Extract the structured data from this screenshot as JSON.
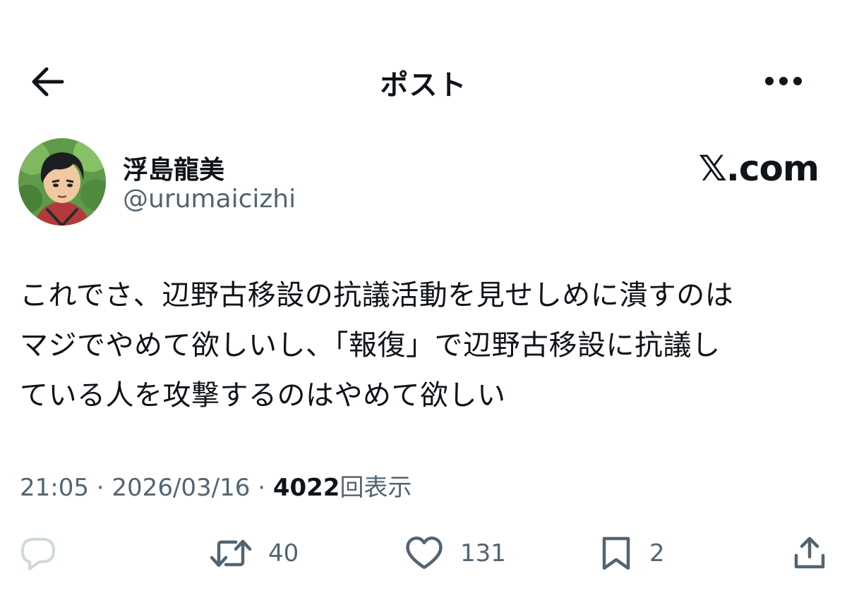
{
  "header": {
    "title": "ポスト",
    "back_icon": "arrow-left-icon",
    "more_icon": "more-horizontal-icon"
  },
  "author": {
    "display_name": "浮島龍美",
    "handle": "@urumaicizhi"
  },
  "brand": {
    "label": "𝕏.com"
  },
  "post": {
    "text": "これでさ、辺野古移設の抗議活動を見せしめに潰すのは\nマジでやめて欲しいし、「報復」で辺野古移設に抗議し\nている人を攻撃するのはやめて欲しい"
  },
  "meta": {
    "time": "21:05",
    "separator": "·",
    "date": "2026/03/16",
    "views_count": "4022",
    "views_label": "回表示"
  },
  "actions": {
    "reply": {
      "icon": "reply-icon"
    },
    "repost": {
      "icon": "repost-icon",
      "count": "40"
    },
    "like": {
      "icon": "heart-icon",
      "count": "131"
    },
    "bookmark": {
      "icon": "bookmark-icon",
      "count": "2"
    },
    "share": {
      "icon": "share-icon"
    }
  },
  "colors": {
    "text_primary": "#0f1419",
    "text_secondary": "#536471",
    "icon_gray": "#536471",
    "disabled_reply": "#cfd9de"
  }
}
